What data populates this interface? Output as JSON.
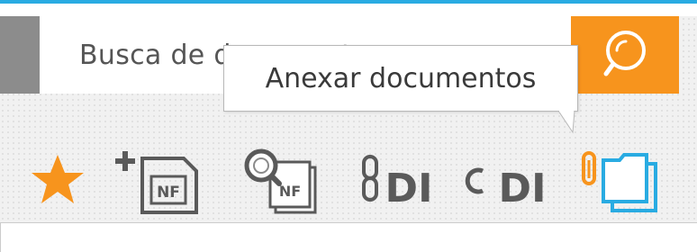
{
  "search": {
    "placeholder": "Busca de documentos"
  },
  "tooltip": {
    "text": "Anexar documentos"
  },
  "toolbar": {
    "nf_label": "NF",
    "di_label": "DI"
  },
  "icons": {
    "search": "search-magnifier-icon",
    "favorite": "star-icon",
    "add_nf": "add-nf-document-icon",
    "search_nf": "search-nf-document-icon",
    "link_di": "link-di-icon",
    "unlink_di": "unlink-di-icon",
    "attach": "attach-folder-icon"
  },
  "colors": {
    "accent_orange": "#f7941d",
    "accent_blue": "#29abe2",
    "icon_gray": "#5a5a5a"
  }
}
